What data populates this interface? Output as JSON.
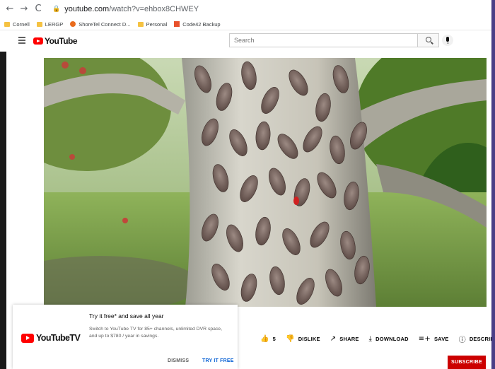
{
  "browser": {
    "url_host": "youtube.com",
    "url_path": "/watch?v=ehbox8CHWEY",
    "bookmarks": [
      {
        "label": "Cornell",
        "icon": "folder-icon"
      },
      {
        "label": "LERGP",
        "icon": "folder-icon"
      },
      {
        "label": "ShoreTel Connect D...",
        "icon": "shoretel-icon"
      },
      {
        "label": "Personal",
        "icon": "folder-icon"
      },
      {
        "label": "Code42 Backup",
        "icon": "code42-icon"
      }
    ]
  },
  "header": {
    "logo_text": "YouTube",
    "search_placeholder": "Search"
  },
  "video": {
    "scene": "spotted-lanternflies-on-tree-trunk"
  },
  "actions": {
    "like_count": "5",
    "dislike": "DISLIKE",
    "share": "SHARE",
    "download": "DOWNLOAD",
    "save": "SAVE",
    "description": "DESCRIPTION",
    "more": "···"
  },
  "subscribe": "SUBSCRIBE",
  "promo": {
    "logo_text": "YouTubeTV",
    "title": "Try it free* and save all year",
    "body": "Switch to YouTube TV for 85+ channels, unlimited DVR space, and up to $780 / year in savings.",
    "dismiss": "DISMISS",
    "try_free": "TRY IT FREE"
  },
  "colors": {
    "brand_red": "#ff0000",
    "subscribe_red": "#cc0000",
    "link_blue": "#065fd4",
    "desktop_purple": "#4a3f86"
  }
}
